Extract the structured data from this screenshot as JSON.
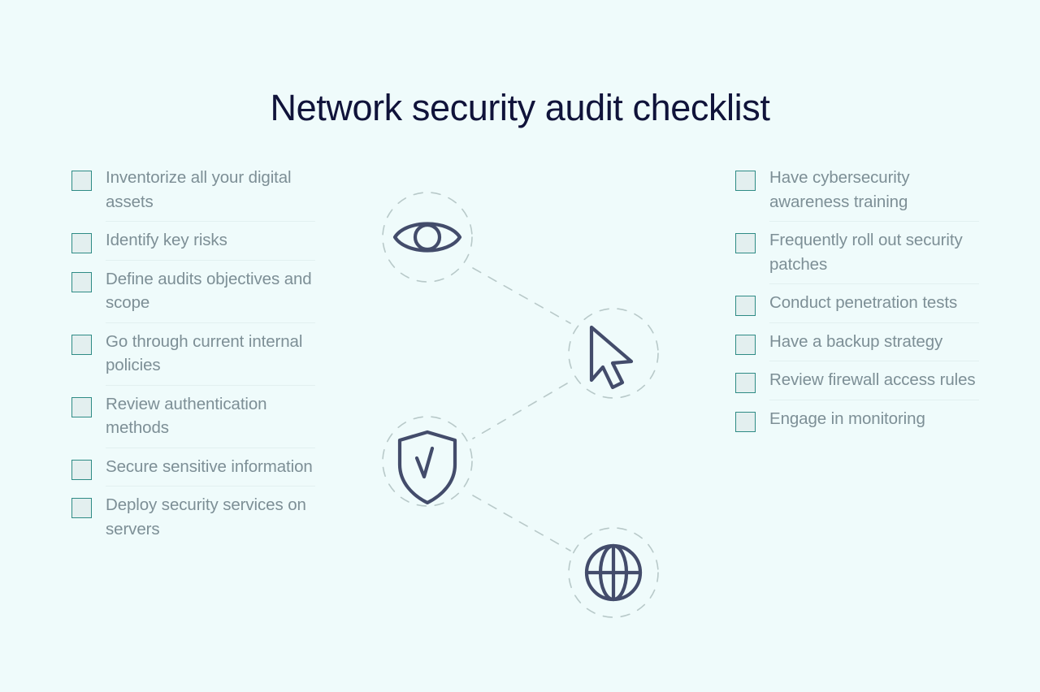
{
  "page": {
    "title": "Network security audit checklist",
    "background_color": "#effbfb",
    "title_color": "#10133a",
    "label_color": "#7d8f96",
    "checkbox_border_color": "#2e8b85",
    "checkbox_fill_color": "#e3efef",
    "divider_color": "#e2f0f0",
    "icon_color": "#434c6b",
    "dashed_color": "#b8c9c9"
  },
  "checklist": {
    "left": [
      {
        "label": "Inventorize all your digital assets",
        "checked": false
      },
      {
        "label": "Identify key risks",
        "checked": false
      },
      {
        "label": "Define audits objectives and scope",
        "checked": false
      },
      {
        "label": "Go through current internal policies",
        "checked": false
      },
      {
        "label": "Review authentication methods",
        "checked": false
      },
      {
        "label": "Secure sensitive information",
        "checked": false
      },
      {
        "label": "Deploy security services on servers",
        "checked": false
      }
    ],
    "right": [
      {
        "label": "Have cybersecurity awareness training",
        "checked": false
      },
      {
        "label": "Frequently roll out security patches",
        "checked": false
      },
      {
        "label": "Conduct penetration tests",
        "checked": false
      },
      {
        "label": "Have a backup strategy",
        "checked": false
      },
      {
        "label": "Review firewall access rules",
        "checked": false
      },
      {
        "label": "Engage in monitoring",
        "checked": false
      }
    ]
  },
  "diagram": {
    "nodes": [
      {
        "icon": "eye-icon",
        "label": "Eye"
      },
      {
        "icon": "cursor-icon",
        "label": "Cursor"
      },
      {
        "icon": "shield-check-icon",
        "label": "Shield with checkmark"
      },
      {
        "icon": "globe-icon",
        "label": "Globe"
      }
    ],
    "connections": [
      {
        "from": "eye-icon",
        "to": "cursor-icon"
      },
      {
        "from": "cursor-icon",
        "to": "shield-check-icon"
      },
      {
        "from": "shield-check-icon",
        "to": "globe-icon"
      }
    ]
  }
}
